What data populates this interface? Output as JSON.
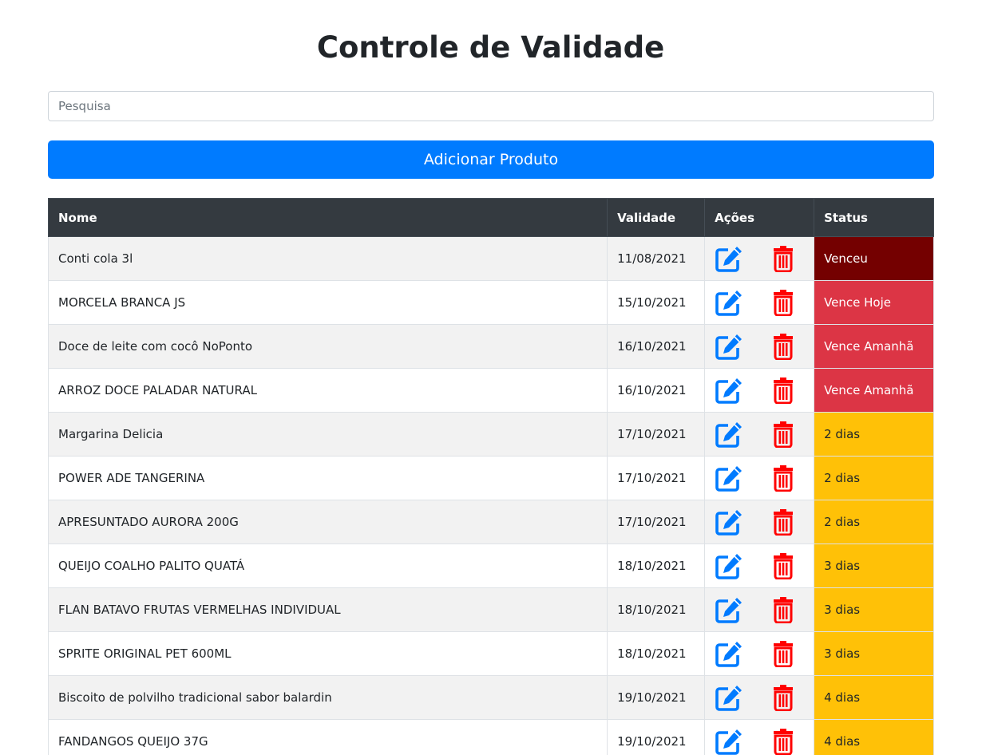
{
  "page": {
    "title": "Controle de Validade"
  },
  "search": {
    "placeholder": "Pesquisa",
    "value": ""
  },
  "add_button": {
    "label": "Adicionar Produto"
  },
  "table": {
    "headers": {
      "name": "Nome",
      "date": "Validade",
      "actions": "Ações",
      "status": "Status"
    },
    "rows": [
      {
        "name": "Conti cola 3l",
        "date": "11/08/2021",
        "status": "Venceu",
        "status_type": "expired"
      },
      {
        "name": "MORCELA BRANCA JS",
        "date": "15/10/2021",
        "status": "Vence Hoje",
        "status_type": "danger"
      },
      {
        "name": "Doce de leite com cocô NoPonto",
        "date": "16/10/2021",
        "status": "Vence Amanhã",
        "status_type": "danger"
      },
      {
        "name": "ARROZ DOCE PALADAR NATURAL",
        "date": "16/10/2021",
        "status": "Vence Amanhã",
        "status_type": "danger"
      },
      {
        "name": "Margarina Delicia",
        "date": "17/10/2021",
        "status": "2 dias",
        "status_type": "warning"
      },
      {
        "name": "POWER ADE TANGERINA",
        "date": "17/10/2021",
        "status": "2 dias",
        "status_type": "warning"
      },
      {
        "name": "APRESUNTADO AURORA 200G",
        "date": "17/10/2021",
        "status": "2 dias",
        "status_type": "warning"
      },
      {
        "name": "QUEIJO COALHO PALITO QUATÁ",
        "date": "18/10/2021",
        "status": "3 dias",
        "status_type": "warning"
      },
      {
        "name": "FLAN BATAVO FRUTAS VERMELHAS INDIVIDUAL",
        "date": "18/10/2021",
        "status": "3 dias",
        "status_type": "warning"
      },
      {
        "name": "SPRITE ORIGINAL PET 600ML",
        "date": "18/10/2021",
        "status": "3 dias",
        "status_type": "warning"
      },
      {
        "name": "Biscoito de polvilho tradicional sabor balardin",
        "date": "19/10/2021",
        "status": "4 dias",
        "status_type": "warning"
      },
      {
        "name": "FANDANGOS QUEIJO 37G",
        "date": "19/10/2021",
        "status": "4 dias",
        "status_type": "warning"
      }
    ]
  },
  "icons": {
    "edit": "edit-icon",
    "delete": "trash-icon"
  },
  "colors": {
    "primary": "#007bff",
    "header_bg": "#343a40",
    "expired": "#740000",
    "danger": "#dc3545",
    "warning": "#ffc107",
    "trash": "#ff0000"
  }
}
